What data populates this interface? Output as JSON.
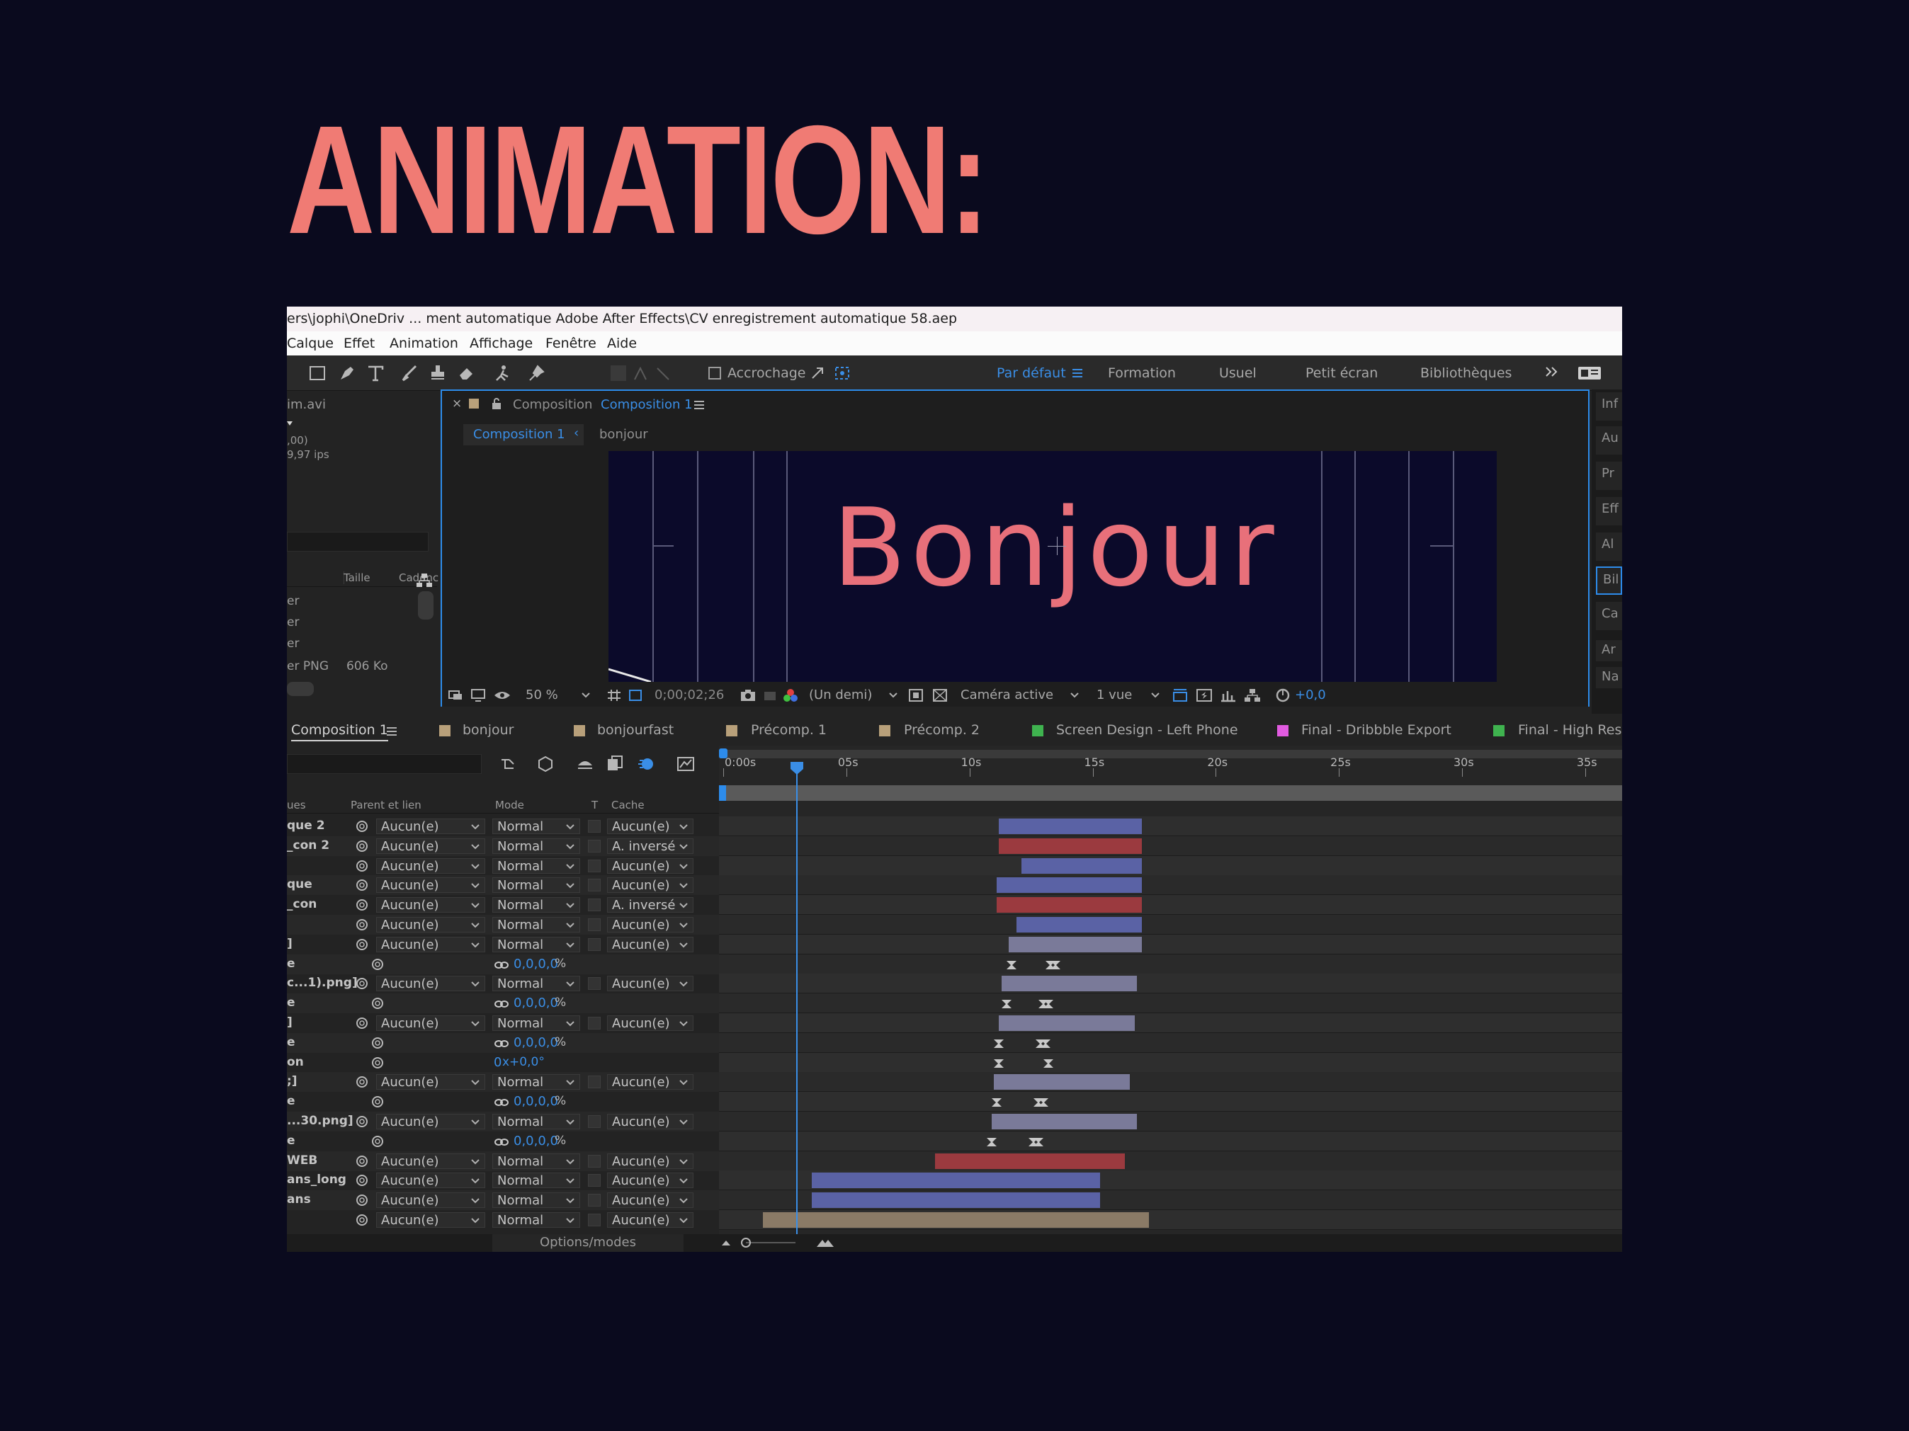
{
  "heading": "ANIMATION:",
  "titlebar": {
    "path": "ers\\jophi\\OneDriv ... ment automatique Adobe After Effects\\CV enregistrement automatique 58.aep"
  },
  "menu": [
    "Calque",
    "Effet",
    "Animation",
    "Affichage",
    "Fenêtre",
    "Aide"
  ],
  "toolbar": {
    "snapping": "Accrochage",
    "workspaces": [
      "Par défaut",
      "Formation",
      "Usuel",
      "Petit écran",
      "Bibliothèques"
    ],
    "active_workspace": "Par défaut"
  },
  "project": {
    "file": "im.avi",
    "info1": ",00)",
    "info2": "9,97 ips",
    "col_size": "Taille",
    "col_rate": "Cadenc",
    "items": [
      {
        "name": "er",
        "size": ""
      },
      {
        "name": "er",
        "size": ""
      },
      {
        "name": "er",
        "size": ""
      },
      {
        "name": "er PNG",
        "size": "606 Ko"
      }
    ]
  },
  "comp_panel": {
    "label": "Composition",
    "name": "Composition 1",
    "breadcrumb_active": "Composition 1",
    "breadcrumb_child": "bonjour",
    "canvas_text": "Bonjour",
    "zoom": "50 %",
    "timecode": "0;00;02;26",
    "resolution": "(Un demi)",
    "camera": "Caméra active",
    "views": "1 vue",
    "exposure": "+0,0"
  },
  "right_panel": [
    "Inf",
    "Au",
    "Pr",
    "Eff",
    "Al",
    "Bil",
    "Ca",
    "Ar",
    "Na"
  ],
  "timeline_tabs": [
    {
      "label": "Composition 1",
      "color": "",
      "active": true
    },
    {
      "label": "bonjour",
      "color": "#b8a07a"
    },
    {
      "label": "bonjourfast",
      "color": "#b8a07a"
    },
    {
      "label": "Précomp. 1",
      "color": "#b8a07a"
    },
    {
      "label": "Précomp. 2",
      "color": "#b8a07a"
    },
    {
      "label": "Screen Design - Left Phone",
      "color": "#3fb34f"
    },
    {
      "label": "Final - Dribbble Export",
      "color": "#e15be0"
    },
    {
      "label": "Final - High Res",
      "color": "#3fb34f"
    }
  ],
  "timeline": {
    "columns": {
      "name": "ues",
      "parent": "Parent et lien",
      "mode": "Mode",
      "t": "T",
      "matte": "Cache"
    },
    "ruler": [
      "0:00s",
      "05s",
      "10s",
      "15s",
      "20s",
      "25s",
      "30s",
      "35s"
    ],
    "ruler_end_seconds": 36.5,
    "playhead_seconds": 3,
    "footer": "Options/modes",
    "layers": [
      {
        "name": "que 2",
        "parent": "Aucun(e)",
        "mode": "Normal",
        "matte": "Aucun(e)",
        "bar": {
          "start": 11.2,
          "end": 17,
          "color": "#5a62a5"
        }
      },
      {
        "name": "_con 2",
        "parent": "Aucun(e)",
        "mode": "Normal",
        "matte": "A. inversé",
        "bar": {
          "start": 11.2,
          "end": 17,
          "color": "#9b3a3f"
        }
      },
      {
        "name": "",
        "parent": "Aucun(e)",
        "mode": "Normal",
        "matte": "Aucun(e)",
        "bar": {
          "start": 12.1,
          "end": 17,
          "color": "#5a62a5"
        }
      },
      {
        "name": "que",
        "parent": "Aucun(e)",
        "mode": "Normal",
        "matte": "Aucun(e)",
        "bar": {
          "start": 11.1,
          "end": 17,
          "color": "#5a62a5"
        }
      },
      {
        "name": "_con",
        "parent": "Aucun(e)",
        "mode": "Normal",
        "matte": "A. inversé",
        "bar": {
          "start": 11.1,
          "end": 17,
          "color": "#9b3a3f"
        }
      },
      {
        "name": "",
        "parent": "Aucun(e)",
        "mode": "Normal",
        "matte": "Aucun(e)",
        "bar": {
          "start": 11.9,
          "end": 17,
          "color": "#5a62a5"
        }
      },
      {
        "name": "]",
        "parent": "Aucun(e)",
        "mode": "Normal",
        "matte": "Aucun(e)",
        "bar": {
          "start": 11.6,
          "end": 17,
          "color": "#7a7a99"
        }
      },
      {
        "name": "e",
        "prop": true,
        "value": "0,0,0,0",
        "unit": "%",
        "linked": true,
        "keys": [
          11.7,
          13.3,
          13.5
        ]
      },
      {
        "name": "c...1).png]",
        "parent": "Aucun(e)",
        "mode": "Normal",
        "matte": "Aucun(e)",
        "bar": {
          "start": 11.3,
          "end": 16.8,
          "color": "#7a7a99"
        }
      },
      {
        "name": "e",
        "prop": true,
        "value": "0,0,0,0",
        "unit": "%",
        "linked": true,
        "keys": [
          11.5,
          13.0,
          13.2
        ]
      },
      {
        "name": "]",
        "parent": "Aucun(e)",
        "mode": "Normal",
        "matte": "Aucun(e)",
        "bar": {
          "start": 11.2,
          "end": 16.7,
          "color": "#7a7a99"
        }
      },
      {
        "name": "e",
        "prop": true,
        "value": "0,0,0,0",
        "unit": "%",
        "linked": true,
        "keys": [
          11.2,
          12.9,
          13.1
        ]
      },
      {
        "name": "on",
        "prop": true,
        "value": "0",
        "suffix": "x+0,0°",
        "keys": [
          11.2,
          13.2
        ]
      },
      {
        "name": ";]",
        "parent": "Aucun(e)",
        "mode": "Normal",
        "matte": "Aucun(e)",
        "bar": {
          "start": 11.0,
          "end": 16.5,
          "color": "#7a7a99"
        }
      },
      {
        "name": "e",
        "prop": true,
        "value": "0,0,0,0",
        "unit": "%",
        "linked": true,
        "keys": [
          11.1,
          12.8,
          13.0
        ]
      },
      {
        "name": "...30.png]",
        "parent": "Aucun(e)",
        "mode": "Normal",
        "matte": "Aucun(e)",
        "bar": {
          "start": 10.9,
          "end": 16.8,
          "color": "#7a7a99"
        }
      },
      {
        "name": "e",
        "prop": true,
        "value": "0,0,0,0",
        "unit": "%",
        "linked": true,
        "keys": [
          10.9,
          12.6,
          12.8
        ]
      },
      {
        "name": "WEB",
        "parent": "Aucun(e)",
        "mode": "Normal",
        "matte": "Aucun(e)",
        "bar": {
          "start": 8.6,
          "end": 16.3,
          "color": "#9b3a3f"
        }
      },
      {
        "name": "ans_long",
        "parent": "Aucun(e)",
        "mode": "Normal",
        "matte": "Aucun(e)",
        "bar": {
          "start": 3.6,
          "end": 15.3,
          "color": "#5a62a5"
        }
      },
      {
        "name": "ans",
        "parent": "Aucun(e)",
        "mode": "Normal",
        "matte": "Aucun(e)",
        "bar": {
          "start": 3.6,
          "end": 15.3,
          "color": "#5a62a5"
        }
      },
      {
        "name": "",
        "parent": "Aucun(e)",
        "mode": "Normal",
        "matte": "Aucun(e)",
        "bar": {
          "start": 1.6,
          "end": 17.3,
          "color": "#8a7a66"
        }
      }
    ]
  }
}
